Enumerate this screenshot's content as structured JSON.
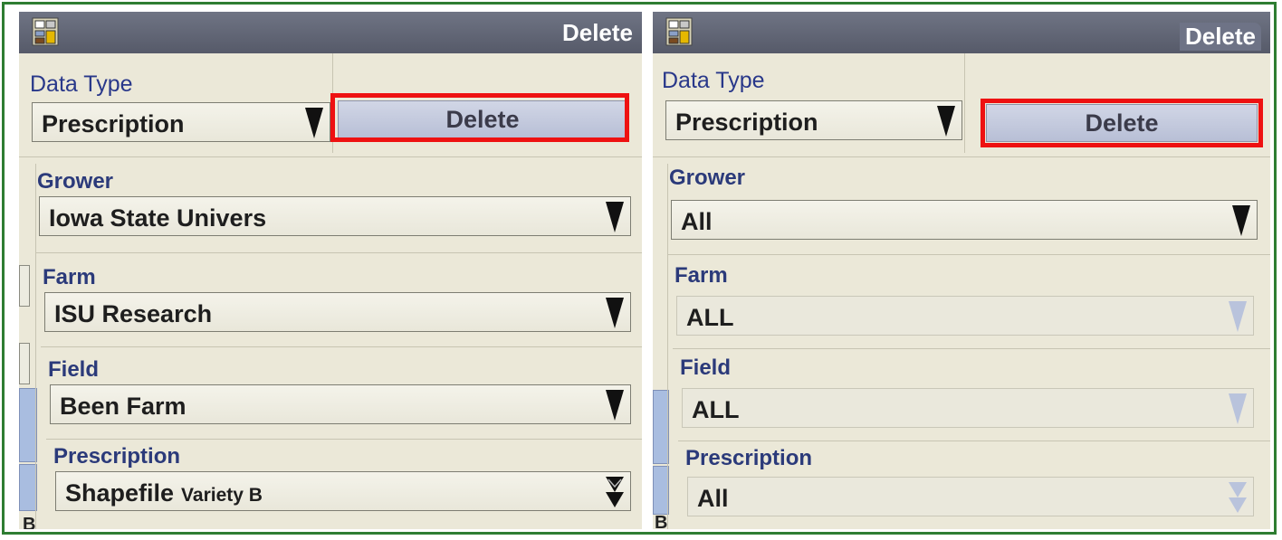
{
  "colors": {
    "frame_border": "#2e7d32",
    "highlight": "#ee1111",
    "label_text": "#2b3a7a",
    "titlebar": "#5f6373"
  },
  "panels": [
    {
      "title": "Delete",
      "data_type": {
        "label": "Data Type",
        "value": "Prescription"
      },
      "delete_button": "Delete",
      "fields": [
        {
          "label": "Grower",
          "value": "Iowa State Univers",
          "sub": "",
          "disabled": false
        },
        {
          "label": "Farm",
          "value": "ISU Research",
          "sub": "",
          "disabled": false
        },
        {
          "label": "Field",
          "value": "Been Farm",
          "sub": "",
          "disabled": false
        },
        {
          "label": "Prescription",
          "value": "Shapefile",
          "sub": "Variety B",
          "disabled": false
        }
      ],
      "edge_label": "B"
    },
    {
      "title": "Delete",
      "data_type": {
        "label": "Data Type",
        "value": "Prescription"
      },
      "delete_button": "Delete",
      "fields": [
        {
          "label": "Grower",
          "value": "All",
          "sub": "",
          "disabled": false
        },
        {
          "label": "Farm",
          "value": "ALL",
          "sub": "",
          "disabled": true
        },
        {
          "label": "Field",
          "value": "ALL",
          "sub": "",
          "disabled": true
        },
        {
          "label": "Prescription",
          "value": "All",
          "sub": "",
          "disabled": true
        }
      ],
      "edge_label": "B"
    }
  ]
}
